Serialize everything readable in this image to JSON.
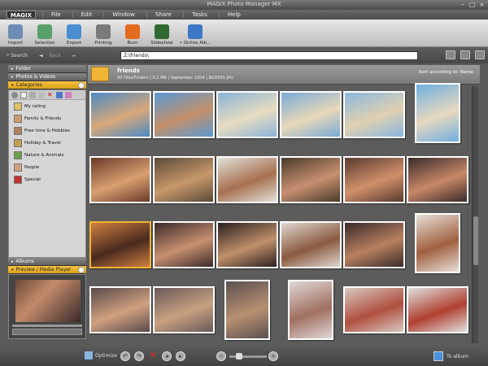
{
  "app": {
    "title": "MAGIX Photo Manager MX",
    "logo": "MAGIX"
  },
  "menu": [
    "File",
    "Edit",
    "Window",
    "Share",
    "Tasks",
    "Help"
  ],
  "toolbar": [
    {
      "label": "Import",
      "icon": "import-icon",
      "color": "#6d8cb5"
    },
    {
      "label": "Selection",
      "icon": "selection-icon",
      "color": "#5aa06a"
    },
    {
      "label": "Export",
      "icon": "export-icon",
      "color": "#4a8fcf"
    },
    {
      "label": "Printing",
      "icon": "printer-icon",
      "color": "#7a7a7a"
    },
    {
      "label": "Burn",
      "icon": "burn-icon",
      "color": "#e36b1e"
    },
    {
      "label": "Slideshow",
      "icon": "slideshow-icon",
      "color": "#2f6b2f"
    },
    {
      "label": "• Online Alb...",
      "icon": "online-album-icon",
      "color": "#3f78c6"
    }
  ],
  "nav": {
    "search": "Search",
    "back": "Back",
    "path": "Z:\\friends\\"
  },
  "left": {
    "folder": "Folder",
    "photos_videos": "Photos & Videos",
    "categories": "Categories",
    "cat_items": [
      {
        "label": "My rating",
        "icon": "rating-icon",
        "color": "#e0c060"
      },
      {
        "label": "Family & Friends",
        "icon": "family-icon",
        "color": "#d09a6a"
      },
      {
        "label": "Free time & Hobbies",
        "icon": "hobbies-icon",
        "color": "#b08060"
      },
      {
        "label": "Holiday & Travel",
        "icon": "travel-icon",
        "color": "#c0a050"
      },
      {
        "label": "Nature & Animals",
        "icon": "nature-icon",
        "color": "#6aa050"
      },
      {
        "label": "People",
        "icon": "people-icon",
        "color": "#d0a080"
      },
      {
        "label": "Special",
        "icon": "special-icon",
        "color": "#c03030"
      }
    ],
    "albums": "Albums",
    "preview": "Preview / Media Player"
  },
  "folder_info": {
    "name": "friends",
    "meta": "93 Files/Folders  |  0.2 MB  |  September 2004  |  BUD055.JPG",
    "sort": "Sort according to: Name"
  },
  "photos": [
    {
      "c1": "#4a8ac4",
      "c2": "#d9a87a"
    },
    {
      "c1": "#5a9ad4",
      "c2": "#c4906a"
    },
    {
      "c1": "#8ab4d8",
      "c2": "#e8dcc0"
    },
    {
      "c1": "#7aaad8",
      "c2": "#e8d8b8"
    },
    {
      "c1": "#8ab8e0",
      "c2": "#e0d0b0"
    },
    {
      "c1": "#70b0e0",
      "c2": "#e8d8c0"
    },
    {
      "c1": "#6a3a2a",
      "c2": "#d8a070"
    },
    {
      "c1": "#5a4a3a",
      "c2": "#c8986a"
    },
    {
      "c1": "#e0e0d8",
      "c2": "#a87050"
    },
    {
      "c1": "#4a3a2a",
      "c2": "#c89070"
    },
    {
      "c1": "#5a3a30",
      "c2": "#d0906a"
    },
    {
      "c1": "#3a2a2a",
      "c2": "#c88868"
    },
    {
      "c1": "#d08040",
      "c2": "#4a2a20"
    },
    {
      "c1": "#3a2a2a",
      "c2": "#c89070"
    },
    {
      "c1": "#2a2020",
      "c2": "#c0906a"
    },
    {
      "c1": "#e0d8d0",
      "c2": "#8a5a40"
    },
    {
      "c1": "#3a2a2a",
      "c2": "#b88060"
    },
    {
      "c1": "#e8e0d8",
      "c2": "#a06040"
    },
    {
      "c1": "#5a4a4a",
      "c2": "#d0a080"
    },
    {
      "c1": "#6a5a5a",
      "c2": "#c8a080"
    },
    {
      "c1": "#5a5050",
      "c2": "#b89070"
    },
    {
      "c1": "#e0d8d8",
      "c2": "#a07060"
    },
    {
      "c1": "#d8c8c0",
      "c2": "#b05040"
    },
    {
      "c1": "#e0e0e0",
      "c2": "#b04030"
    },
    {
      "c1": "#c8b8b0",
      "c2": "#a06050"
    }
  ],
  "bottom": {
    "optimize": "Optimize",
    "to_album": "To album"
  }
}
